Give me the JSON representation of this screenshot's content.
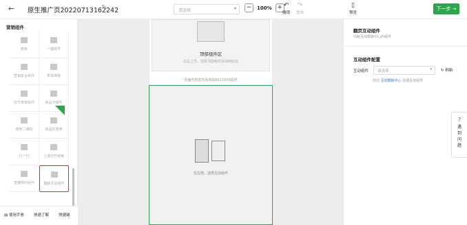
{
  "header": {
    "back_icon": "arrow-left-icon",
    "title": "原生推广页20220713162242",
    "page_select_placeholder": "请选择",
    "zoom_value": "100%",
    "undo_label": "撤销",
    "redo_label": "重做",
    "preview_label": "预览",
    "next_label": "下一步 →"
  },
  "left_panel": {
    "title": "营销组件",
    "components": [
      "表单",
      "一键拨号",
      "营销复合组件",
      "表单弹窗",
      "拉升表单组件",
      "商品卡组件",
      "落地二维码",
      "商品优惠券",
      "打一打",
      "上滑打开链接",
      "直播预约组件",
      "翻转互动组件"
    ],
    "footer": {
      "manual": "使用手册",
      "learn": "快速了解",
      "shortcut": "快捷键"
    }
  },
  "canvas": {
    "top_area_title": "顶部组件区",
    "top_area_hint": "在左上方，选择顶部组件添加到此处",
    "notice": "页面内容发布后将由6021656提供",
    "main_area_hint": "在左侧，选择互动组件"
  },
  "right_panel": {
    "title": "翻页互动组件",
    "subtitle": "内嵌互动模板中心的组件",
    "config_title": "互动组件配置",
    "field_label": "互动组件",
    "select_placeholder": "请选择",
    "refresh_label": "刷新",
    "hint_prefix": "前往",
    "hint_link": "互动模板中心",
    "hint_suffix": "创建互动组件"
  },
  "help": {
    "label": "遇到问题"
  },
  "colors": {
    "accent": "#2ea44f",
    "highlight": "#d9342b",
    "link": "#3a7bd5"
  }
}
